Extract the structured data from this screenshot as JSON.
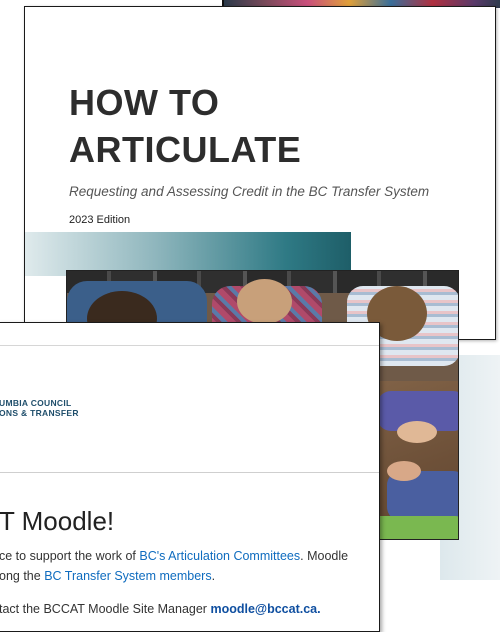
{
  "document": {
    "title": "HOW TO\nARTICULATE",
    "subtitle": "Requesting and Assessing Credit in the BC Transfer System",
    "edition": "2023 Edition"
  },
  "moodle": {
    "logo_line1": "UMBIA COUNCIL",
    "logo_line2": "ONS & TRANSFER",
    "heading": "T Moodle!",
    "para1_text_a": "ce to support the work of ",
    "para1_link": "BC's Articulation Committees",
    "para1_text_b": ". Moodle",
    "para2_text_a": "ong the ",
    "para2_link": "BC Transfer System members",
    "para2_text_b": ".",
    "contact_text": "tact the BCCAT Moodle Site Manager ",
    "contact_email": "moodle@bccat.ca",
    "contact_end": "."
  },
  "colors": {
    "link": "#0f6cbf",
    "logo": "#1f4e6b",
    "teal_accent": "#2f7a85"
  }
}
